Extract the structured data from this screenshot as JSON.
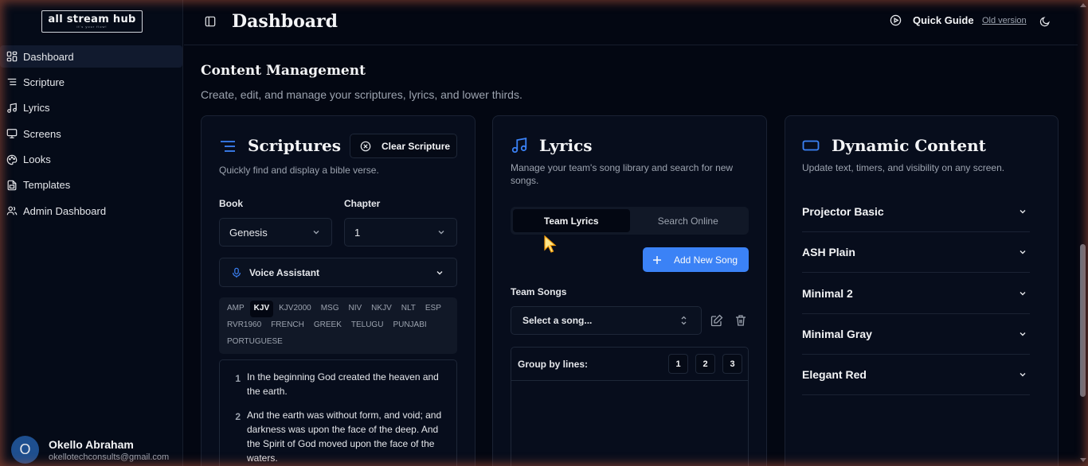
{
  "app": {
    "logo_main": "all stream hub",
    "logo_sub": "it's your flow!"
  },
  "sidebar": {
    "items": [
      {
        "label": "Dashboard",
        "icon": "dashboard-icon",
        "active": true
      },
      {
        "label": "Scripture",
        "icon": "list-icon"
      },
      {
        "label": "Lyrics",
        "icon": "music-icon"
      },
      {
        "label": "Screens",
        "icon": "monitor-icon"
      },
      {
        "label": "Looks",
        "icon": "palette-icon"
      },
      {
        "label": "Templates",
        "icon": "file-icon"
      },
      {
        "label": "Admin Dashboard",
        "icon": "users-icon"
      }
    ],
    "user": {
      "initial": "O",
      "name": "Okello Abraham",
      "email": "okellotechconsults@gmail.com"
    }
  },
  "header": {
    "title": "Dashboard",
    "quick_guide": "Quick Guide",
    "old_version": "Old version"
  },
  "main": {
    "title": "Content Management",
    "subtitle": "Create, edit, and manage your scriptures, lyrics, and lower thirds."
  },
  "scriptures": {
    "title": "Scriptures",
    "desc": "Quickly find and display a bible verse.",
    "clear_label": "Clear Scripture",
    "book_label": "Book",
    "book_value": "Genesis",
    "chapter_label": "Chapter",
    "chapter_value": "1",
    "voice_label": "Voice Assistant",
    "versions": [
      "AMP",
      "KJV",
      "KJV2000",
      "MSG",
      "NIV",
      "NKJV",
      "NLT",
      "ESP",
      "RVR1960",
      "FRENCH",
      "GREEK",
      "TELUGU",
      "PUNJABI",
      "PORTUGUESE"
    ],
    "active_version": "KJV",
    "verses": [
      {
        "num": "1",
        "text": "In the beginning God created the heaven and the earth."
      },
      {
        "num": "2",
        "text": "And the earth was without form, and void; and darkness was upon the face of the deep. And the Spirit of God moved upon the face of the waters."
      }
    ]
  },
  "lyrics": {
    "title": "Lyrics",
    "desc": "Manage your team's song library and search for new songs.",
    "tab_team": "Team Lyrics",
    "tab_search": "Search Online",
    "add_label": "Add New Song",
    "songs_label": "Team Songs",
    "select_placeholder": "Select a song...",
    "group_label": "Group by lines:",
    "group_options": [
      "1",
      "2",
      "3"
    ]
  },
  "dynamic": {
    "title": "Dynamic Content",
    "desc": "Update text, timers, and visibility on any screen.",
    "items": [
      "Projector Basic",
      "ASH Plain",
      "Minimal 2",
      "Minimal Gray",
      "Elegant Red"
    ]
  },
  "colors": {
    "accent": "#3b82f6",
    "background": "#030712",
    "card": "#070d1c"
  }
}
